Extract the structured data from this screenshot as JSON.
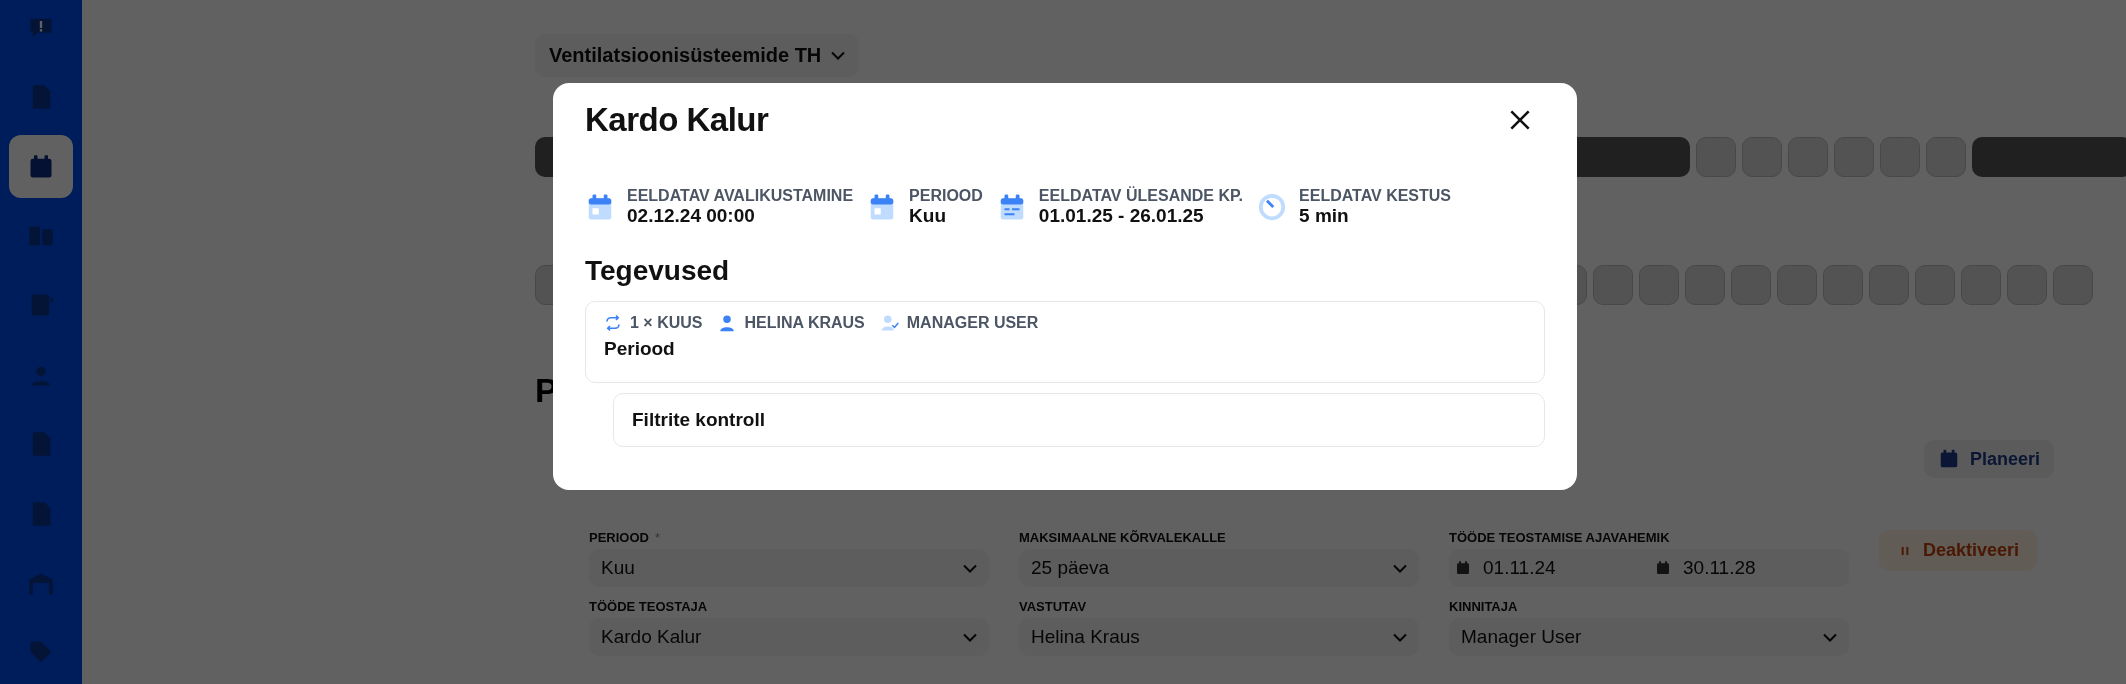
{
  "sidebar": {
    "items": [
      {
        "selected": false
      },
      {
        "selected": false
      },
      {
        "selected": true
      },
      {
        "selected": false
      },
      {
        "selected": false
      },
      {
        "selected": false
      },
      {
        "selected": false
      },
      {
        "selected": false
      },
      {
        "selected": false
      },
      {
        "selected": false
      }
    ]
  },
  "page": {
    "dropdown": "Ventilatsioonisüsteemide TH",
    "heading": "P",
    "plan_button": "Planeeri",
    "deactivate_button": "Deaktiveeri",
    "fields": [
      {
        "kind": "select",
        "label": "PERIOOD",
        "required_mark": "*",
        "value": "Kuu"
      },
      {
        "kind": "select",
        "label": "MAKSIMAALNE KÕRVALEKALLE",
        "value": "25 päeva"
      },
      {
        "kind": "daterange",
        "label": "TÖÖDE TEOSTAMISE AJAVAHEMIK",
        "from": "01.11.24",
        "to": "30.11.28"
      },
      {
        "kind": "select",
        "label": "TÖÖDE TEOSTAJA",
        "value": "Kardo Kalur"
      },
      {
        "kind": "select",
        "label": "VASTUTAV",
        "value": "Helina Kraus"
      },
      {
        "kind": "select",
        "label": "KINNITAJA",
        "value": "Manager User"
      }
    ]
  },
  "modal": {
    "title": "Kardo Kalur",
    "info": [
      {
        "kind": "calendar",
        "label": "EELDATAV AVALIKUSTAMINE",
        "value": "02.12.24 00:00"
      },
      {
        "kind": "calendar",
        "label": "PERIOOD",
        "value": "Kuu"
      },
      {
        "kind": "range",
        "label": "EELDATAV ÜLESANDE KP.",
        "value": "01.01.25 - 26.01.25"
      },
      {
        "kind": "timer",
        "label": "EELDATAV KESTUS",
        "value": "5 min"
      }
    ],
    "section_title": "Tegevused",
    "activity": {
      "repeat": "1 × KUUS",
      "responsible": "HELINA KRAUS",
      "approver": "MANAGER USER",
      "title": "Periood",
      "children": [
        {
          "title": "Filtrite kontroll"
        }
      ]
    }
  }
}
